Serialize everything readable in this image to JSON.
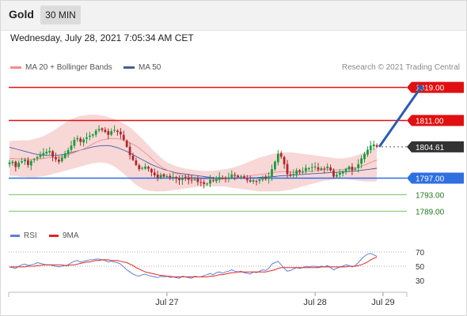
{
  "header": {
    "symbol": "Gold",
    "timeframe": "30 MIN"
  },
  "datetime": "Wednesday, July 28, 2021 7:05:34 AM CET",
  "legend": {
    "ma20_label": "MA 20 + Bollinger Bands",
    "ma50_label": "MA 50",
    "credit": "Research © 2021 Trading Central"
  },
  "rsi_legend": {
    "rsi_label": "RSI",
    "ma_label": "9MA"
  },
  "colors": {
    "up": "#1a9c3b",
    "down": "#b0282a",
    "bollinger": "#f6c9c9",
    "ma20": "#ef8f8f",
    "ma50": "#3f5f9f",
    "resistance": "#e01010",
    "pivot": "#2f6fe0",
    "support": "#6dbb4c",
    "last_price": "#333333",
    "rsi": "#5b7fd6",
    "rsi_ma": "#e52222"
  },
  "chart_data": [
    {
      "type": "candlestick",
      "title": "",
      "bars": 120,
      "ylim": [
        1786,
        1822
      ],
      "series": [
        {
          "name": "Price",
          "values": [
            1800.8,
            1801.0,
            1799.7,
            1800.7,
            1801.1,
            1801.5,
            1800.2,
            1801.2,
            1801.6,
            1802.1,
            1802.6,
            1803.1,
            1803.4,
            1803.6,
            1802.2,
            1801.6,
            1801.0,
            1802.0,
            1803.0,
            1803.8,
            1804.9,
            1806.3,
            1806.7,
            1805.8,
            1806.4,
            1806.9,
            1807.3,
            1807.6,
            1808.5,
            1808.9,
            1808.7,
            1808.2,
            1807.5,
            1808.4,
            1808.7,
            1808.2,
            1807.6,
            1806.3,
            1804.6,
            1802.6,
            1801.4,
            1800.2,
            1799.2,
            1799.5,
            1799.8,
            1799.3,
            1798.4,
            1797.7,
            1797.1,
            1797.8,
            1797.4,
            1797.5,
            1797.1,
            1797.3,
            1796.9,
            1796.5,
            1797.1,
            1797.0,
            1796.6,
            1796.5,
            1796.7,
            1796.1,
            1796.0,
            1795.6,
            1795.7,
            1796.6,
            1796.4,
            1796.8,
            1797.3,
            1797.0,
            1796.9,
            1797.2,
            1797.9,
            1797.6,
            1797.3,
            1797.4,
            1797.0,
            1796.5,
            1796.2,
            1796.5,
            1796.2,
            1796.7,
            1797.1,
            1796.8,
            1797.4,
            1799.2,
            1801.0,
            1802.9,
            1802.2,
            1800.4,
            1798.0,
            1797.6,
            1798.0,
            1798.9,
            1798.5,
            1798.7,
            1799.5,
            1799.4,
            1799.7,
            1799.8,
            1799.1,
            1799.4,
            1799.3,
            1799.8,
            1798.9,
            1797.4,
            1797.8,
            1798.3,
            1798.7,
            1799.3,
            1799.8,
            1798.9,
            1799.3,
            1800.4,
            1801.8,
            1802.9,
            1803.9,
            1804.9,
            1805.2,
            1804.6
          ]
        }
      ],
      "ma20": [
        1801.8,
        1801.8,
        1801.7,
        1801.7,
        1801.7,
        1801.7,
        1801.6,
        1801.6,
        1801.6,
        1801.7,
        1801.7,
        1801.8,
        1801.9,
        1802.0,
        1802.0,
        1802.0,
        1802.1,
        1802.2,
        1802.4,
        1802.6,
        1802.9,
        1803.2,
        1803.5,
        1803.8,
        1804.1,
        1804.5,
        1804.9,
        1805.3,
        1805.7,
        1806.0,
        1806.3,
        1806.4,
        1806.6,
        1806.6,
        1806.6,
        1806.6,
        1806.4,
        1806.2,
        1806.0,
        1805.6,
        1805.2,
        1804.8,
        1804.3,
        1803.7,
        1803.1,
        1802.5,
        1801.8,
        1801.1,
        1800.4,
        1799.9,
        1799.4,
        1799.0,
        1798.6,
        1798.4,
        1798.1,
        1797.9,
        1797.7,
        1797.5,
        1797.3,
        1797.2,
        1797.1,
        1797.0,
        1796.9,
        1796.8,
        1796.8,
        1796.8,
        1796.7,
        1796.7,
        1796.7,
        1796.8,
        1796.8,
        1796.9,
        1797.0,
        1797.1,
        1797.2,
        1797.3,
        1797.4,
        1797.5,
        1797.6,
        1797.7,
        1797.8,
        1797.9,
        1798.0,
        1798.1,
        1798.2,
        1798.3,
        1798.4,
        1798.5,
        1798.6,
        1798.6,
        1798.6,
        1798.5,
        1798.4,
        1798.4,
        1798.4,
        1798.4,
        1798.5,
        1798.6,
        1798.7,
        1798.8,
        1798.9,
        1799.0,
        1799.1,
        1799.1,
        1799.1,
        1799.1,
        1799.0,
        1799.0,
        1799.1,
        1799.2,
        1799.3,
        1799.4,
        1799.5,
        1799.7,
        1799.9,
        1800.2,
        1800.5,
        1800.8,
        1801.1,
        1801.4
      ],
      "ma50": [
        1804.5,
        1804.3,
        1804.1,
        1803.9,
        1803.7,
        1803.5,
        1803.3,
        1803.1,
        1802.9,
        1802.8,
        1802.7,
        1802.6,
        1802.5,
        1802.5,
        1802.5,
        1802.5,
        1802.6,
        1802.7,
        1802.8,
        1803.0,
        1803.2,
        1803.4,
        1803.6,
        1803.8,
        1804.0,
        1804.2,
        1804.4,
        1804.6,
        1804.7,
        1804.8,
        1804.9,
        1804.9,
        1804.9,
        1804.8,
        1804.6,
        1804.4,
        1804.1,
        1803.8,
        1803.5,
        1803.1,
        1802.7,
        1802.3,
        1801.9,
        1801.5,
        1801.1,
        1800.7,
        1800.3,
        1800.0,
        1799.7,
        1799.4,
        1799.1,
        1798.9,
        1798.7,
        1798.5,
        1798.3,
        1798.2,
        1798.1,
        1798.0,
        1797.9,
        1797.8,
        1797.7,
        1797.6,
        1797.5,
        1797.4,
        1797.3,
        1797.2,
        1797.1,
        1797.0,
        1796.9,
        1796.9,
        1796.9,
        1796.9,
        1796.9,
        1796.9,
        1797.0,
        1797.0,
        1797.0,
        1797.0,
        1797.1,
        1797.1,
        1797.1,
        1797.2,
        1797.2,
        1797.3,
        1797.3,
        1797.4,
        1797.4,
        1797.5,
        1797.6,
        1797.6,
        1797.7,
        1797.7,
        1797.8,
        1797.8,
        1797.9,
        1797.9,
        1798.0,
        1798.0,
        1798.1,
        1798.1,
        1798.2,
        1798.2,
        1798.3,
        1798.3,
        1798.4,
        1798.4,
        1798.4,
        1798.5,
        1798.5,
        1798.6,
        1798.6,
        1798.7,
        1798.7,
        1798.8,
        1798.9,
        1799.0,
        1799.1,
        1799.2,
        1799.3,
        1799.4
      ],
      "bollinger_upper": [
        1806.0,
        1806.1,
        1806.1,
        1806.1,
        1806.2,
        1806.2,
        1806.2,
        1806.3,
        1806.5,
        1806.7,
        1806.9,
        1807.2,
        1807.6,
        1808.0,
        1808.4,
        1808.9,
        1809.4,
        1809.9,
        1810.4,
        1810.9,
        1811.3,
        1811.6,
        1811.9,
        1812.1,
        1812.2,
        1812.3,
        1812.4,
        1812.4,
        1812.4,
        1812.3,
        1812.2,
        1812.0,
        1811.8,
        1811.6,
        1811.3,
        1811.0,
        1810.6,
        1810.2,
        1809.8,
        1809.3,
        1808.7,
        1808.0,
        1807.3,
        1806.6,
        1805.8,
        1805.0,
        1804.2,
        1803.4,
        1802.7,
        1802.0,
        1801.4,
        1800.9,
        1800.5,
        1800.2,
        1799.9,
        1799.7,
        1799.5,
        1799.3,
        1799.2,
        1799.1,
        1799.0,
        1798.9,
        1798.8,
        1798.8,
        1798.8,
        1798.8,
        1798.8,
        1798.9,
        1799.0,
        1799.1,
        1799.2,
        1799.3,
        1799.5,
        1799.7,
        1799.9,
        1800.2,
        1800.5,
        1800.8,
        1801.1,
        1801.4,
        1801.7,
        1802.0,
        1802.2,
        1802.4,
        1802.6,
        1802.8,
        1803.0,
        1803.1,
        1803.2,
        1803.3,
        1803.3,
        1803.3,
        1803.2,
        1803.1,
        1803.0,
        1802.9,
        1802.8,
        1802.7,
        1802.6,
        1802.5,
        1802.4,
        1802.3,
        1802.2,
        1802.1,
        1802.0,
        1801.9,
        1801.8,
        1801.8,
        1801.8,
        1801.9,
        1802.0,
        1802.2,
        1802.4,
        1802.7,
        1803.0,
        1803.3,
        1803.6,
        1803.9,
        1804.2,
        1804.4
      ],
      "bollinger_lower": [
        1797.6,
        1797.6,
        1797.5,
        1797.4,
        1797.3,
        1797.3,
        1797.2,
        1797.2,
        1797.2,
        1797.3,
        1797.4,
        1797.5,
        1797.6,
        1797.8,
        1798.0,
        1798.2,
        1798.4,
        1798.6,
        1798.8,
        1799.0,
        1799.2,
        1799.4,
        1799.6,
        1799.8,
        1800.0,
        1800.2,
        1800.4,
        1800.6,
        1800.7,
        1800.8,
        1800.8,
        1800.7,
        1800.5,
        1800.2,
        1799.8,
        1799.3,
        1798.7,
        1798.1,
        1797.4,
        1796.7,
        1796.0,
        1795.4,
        1794.9,
        1794.5,
        1794.2,
        1794.0,
        1793.9,
        1793.8,
        1793.8,
        1793.8,
        1793.8,
        1793.9,
        1794.0,
        1794.1,
        1794.2,
        1794.3,
        1794.4,
        1794.5,
        1794.6,
        1794.7,
        1794.8,
        1794.9,
        1795.0,
        1795.0,
        1795.0,
        1795.0,
        1795.0,
        1795.0,
        1795.0,
        1795.0,
        1794.9,
        1794.8,
        1794.7,
        1794.6,
        1794.5,
        1794.4,
        1794.3,
        1794.2,
        1794.1,
        1794.0,
        1793.9,
        1793.8,
        1793.8,
        1793.8,
        1793.8,
        1793.8,
        1793.8,
        1793.8,
        1793.9,
        1794.0,
        1794.1,
        1794.2,
        1794.4,
        1794.6,
        1794.8,
        1795.0,
        1795.2,
        1795.4,
        1795.6,
        1795.8,
        1796.0,
        1796.2,
        1796.4,
        1796.5,
        1796.6,
        1796.7,
        1796.8,
        1796.8,
        1796.8,
        1796.8,
        1796.7,
        1796.6,
        1796.5,
        1796.4,
        1796.3,
        1796.2,
        1796.2,
        1796.2,
        1796.2,
        1796.3
      ],
      "levels": [
        {
          "label": "1819.00",
          "value": 1819.0,
          "kind": "resistance"
        },
        {
          "label": "1811.00",
          "value": 1811.0,
          "kind": "resistance"
        },
        {
          "label": "1804.61",
          "value": 1804.61,
          "kind": "last"
        },
        {
          "label": "1797.00",
          "value": 1797.0,
          "kind": "pivot"
        },
        {
          "label": "1793.00",
          "value": 1793.0,
          "kind": "support"
        },
        {
          "label": "1789.00",
          "value": 1789.0,
          "kind": "support"
        }
      ],
      "forecast_arrow": {
        "from_bar": 119,
        "from_value": 1804.6,
        "to_bar": 134,
        "to_value": 1818.7
      },
      "x_ticks": [
        {
          "label": "Jul 27",
          "bar": 51
        },
        {
          "label": "Jul 28",
          "bar": 99
        },
        {
          "label": "Jul 29",
          "bar": 121
        }
      ]
    },
    {
      "type": "line",
      "title": "",
      "ylim": [
        20,
        80
      ],
      "y_ticks": [
        70,
        50,
        30
      ],
      "series": [
        {
          "name": "RSI",
          "values": [
            49,
            48,
            47,
            50,
            52,
            53,
            51,
            52,
            53,
            55,
            54,
            53,
            52,
            52,
            51,
            50,
            49,
            50,
            51,
            52,
            55,
            57,
            58,
            56,
            57,
            58,
            59,
            59,
            60,
            60,
            59,
            58,
            56,
            57,
            56,
            55,
            53,
            49,
            45,
            42,
            39,
            37,
            36,
            38,
            39,
            37,
            36,
            35,
            34,
            36,
            35,
            36,
            34,
            35,
            34,
            33,
            36,
            35,
            34,
            33,
            36,
            35,
            35,
            37,
            38,
            40,
            38,
            41,
            42,
            40,
            42,
            43,
            45,
            43,
            42,
            43,
            41,
            40,
            39,
            42,
            41,
            43,
            45,
            44,
            47,
            53,
            55,
            57,
            52,
            47,
            43,
            44,
            46,
            48,
            47,
            48,
            50,
            49,
            50,
            50,
            49,
            50,
            49,
            51,
            48,
            45,
            47,
            49,
            50,
            52,
            51,
            49,
            51,
            55,
            60,
            64,
            67,
            68,
            66,
            64
          ]
        },
        {
          "name": "9MA",
          "values": [
            49,
            49,
            49,
            49,
            49,
            49,
            50,
            50,
            50,
            51,
            51,
            52,
            52,
            52,
            52,
            52,
            52,
            52,
            51,
            51,
            52,
            52,
            53,
            54,
            55,
            56,
            56,
            57,
            58,
            58,
            59,
            59,
            59,
            58,
            58,
            58,
            57,
            56,
            55,
            53,
            51,
            48,
            46,
            44,
            42,
            41,
            40,
            39,
            38,
            37,
            37,
            36,
            36,
            35,
            35,
            35,
            35,
            35,
            35,
            35,
            35,
            35,
            35,
            35,
            35,
            36,
            36,
            37,
            38,
            38,
            39,
            40,
            41,
            41,
            42,
            42,
            42,
            42,
            42,
            42,
            42,
            42,
            42,
            42,
            43,
            44,
            45,
            47,
            48,
            48,
            48,
            48,
            48,
            48,
            48,
            48,
            48,
            48,
            48,
            48,
            48,
            49,
            49,
            49,
            49,
            49,
            49,
            49,
            49,
            49,
            50,
            50,
            50,
            51,
            52,
            54,
            56,
            59,
            61,
            63
          ]
        }
      ]
    }
  ]
}
